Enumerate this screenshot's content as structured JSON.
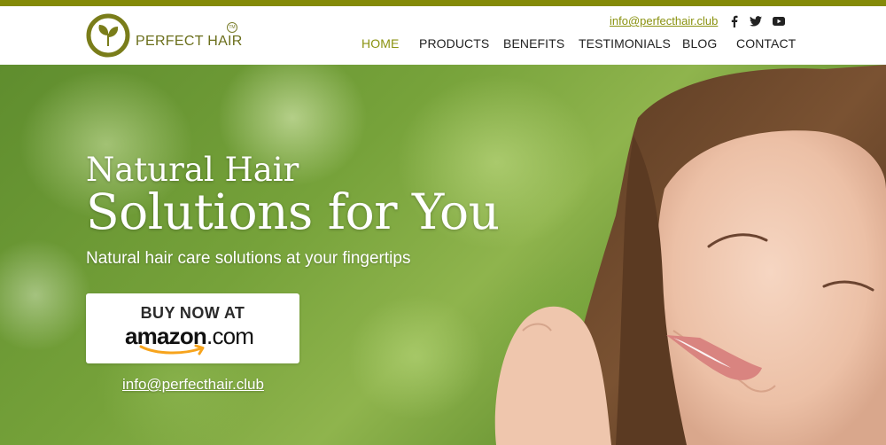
{
  "brand": {
    "name": "PERFECT HAIR",
    "trademark": "TM",
    "accent_color": "#848a08"
  },
  "header": {
    "email": "info@perfecthair.club",
    "social": [
      {
        "icon": "facebook-icon"
      },
      {
        "icon": "twitter-icon"
      },
      {
        "icon": "youtube-icon"
      }
    ],
    "nav": [
      {
        "label": "HOME",
        "active": true
      },
      {
        "label": "PRODUCTS",
        "active": false
      },
      {
        "label": "BENEFITS",
        "active": false
      },
      {
        "label": "TESTIMONIALS",
        "active": false
      },
      {
        "label": "BLOG",
        "active": false
      },
      {
        "label": "CONTACT",
        "active": false
      }
    ]
  },
  "hero": {
    "headline_line1": "Natural Hair",
    "headline_line2": "Solutions for You",
    "subtitle": "Natural hair care solutions at your fingertips",
    "cta": {
      "line1": "BUY NOW AT",
      "store": "amazon",
      "store_suffix": ".com"
    },
    "email": "info@perfecthair.club"
  }
}
